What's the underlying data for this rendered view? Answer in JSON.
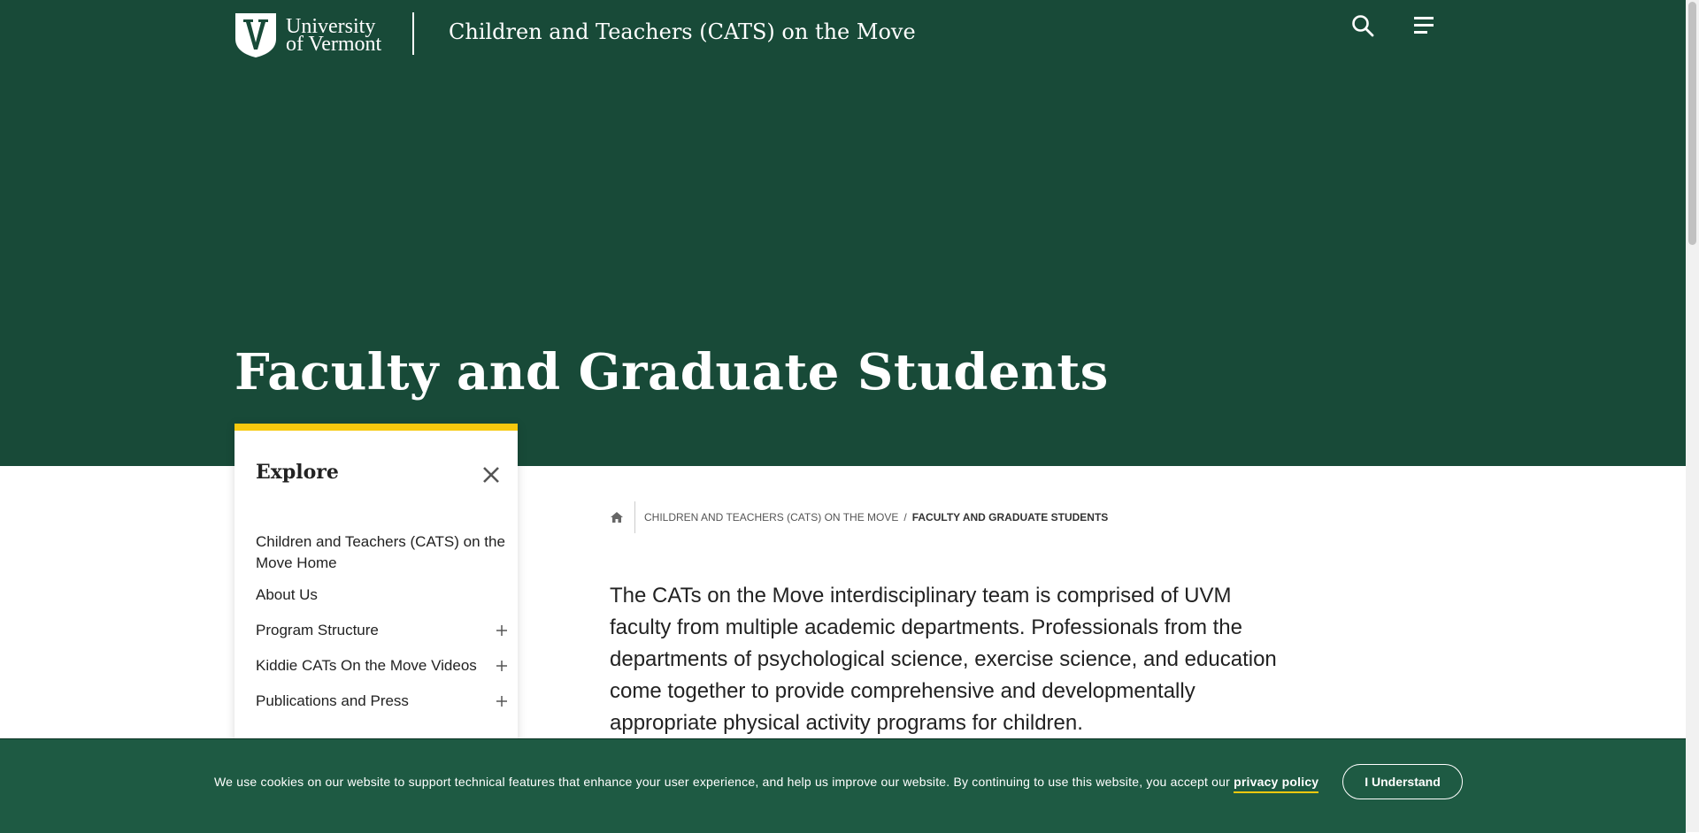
{
  "header": {
    "logo_text_line1": "University",
    "logo_text_line2": "of Vermont",
    "site_title": "Children and Teachers (CATS) on the Move",
    "search_icon": "search-icon",
    "menu_icon": "menu-icon"
  },
  "hero": {
    "page_title": "Faculty and Graduate Students",
    "background_color": "#184a38"
  },
  "explore": {
    "title": "Explore",
    "accent_color": "#f6c90e",
    "items": [
      {
        "label": "Children and Teachers (CATS) on the Move Home",
        "expandable": false
      },
      {
        "label": "About Us",
        "expandable": false
      },
      {
        "label": "Program Structure",
        "expandable": true
      },
      {
        "label": "Kiddie CATs On the Move Videos",
        "expandable": true
      },
      {
        "label": "Publications and Press",
        "expandable": true
      }
    ]
  },
  "breadcrumb": {
    "home_icon": "home-icon",
    "parent": "Children and Teachers (CATS) on the Move",
    "separator": "/",
    "current": "Faculty and Graduate Students"
  },
  "main": {
    "intro_text": "The CATs on the Move interdisciplinary team is comprised of UVM faculty from multiple academic departments. Professionals from the departments of psychological science, exercise science, and education come together to provide comprehensive and developmentally appropriate physical activity programs for children."
  },
  "cookie_banner": {
    "text": "We use cookies on our website to support technical features that enhance your user experience, and help us improve our website. By continuing to use this website, you accept our",
    "link_label": "privacy policy",
    "button_label": "I Understand",
    "background_color": "#1e5a43"
  }
}
